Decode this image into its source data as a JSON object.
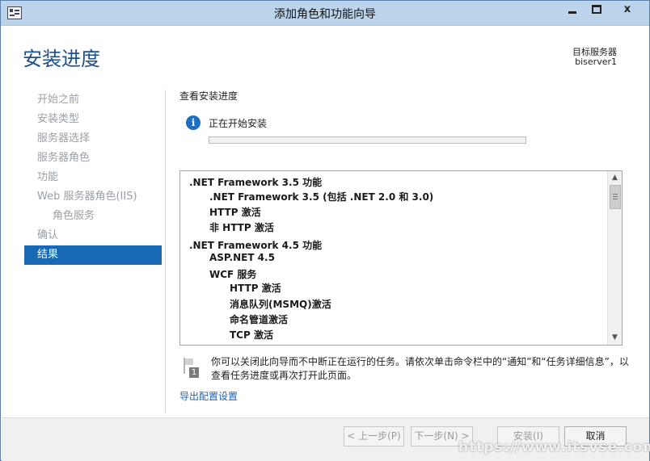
{
  "window": {
    "title": "添加角色和功能向导",
    "close_glyph": "x"
  },
  "header": {
    "title": "安装进度",
    "target_label": "目标服务器",
    "target_value": "biserver1"
  },
  "nav": {
    "items": [
      {
        "label": "开始之前",
        "active": false,
        "sub": false
      },
      {
        "label": "安装类型",
        "active": false,
        "sub": false
      },
      {
        "label": "服务器选择",
        "active": false,
        "sub": false
      },
      {
        "label": "服务器角色",
        "active": false,
        "sub": false
      },
      {
        "label": "功能",
        "active": false,
        "sub": false
      },
      {
        "label": "Web 服务器角色(IIS)",
        "active": false,
        "sub": false
      },
      {
        "label": "角色服务",
        "active": false,
        "sub": true
      },
      {
        "label": "确认",
        "active": false,
        "sub": false
      },
      {
        "label": "结果",
        "active": true,
        "sub": false
      }
    ]
  },
  "main": {
    "section_title": "查看安装进度",
    "status_icon": "info-icon",
    "status_text": "正在开始安装",
    "progress": 0,
    "features": [
      {
        "label": ".NET Framework 3.5 功能",
        "level": 0
      },
      {
        "label": ".NET Framework 3.5 (包括 .NET 2.0 和 3.0)",
        "level": 1
      },
      {
        "label": "HTTP 激活",
        "level": 1
      },
      {
        "label": "非 HTTP 激活",
        "level": 1
      },
      {
        "label": ".NET Framework 4.5 功能",
        "level": 0
      },
      {
        "label": "ASP.NET 4.5",
        "level": 1
      },
      {
        "label": "WCF 服务",
        "level": 1
      },
      {
        "label": "HTTP 激活",
        "level": 2
      },
      {
        "label": "消息队列(MSMQ)激活",
        "level": 2
      },
      {
        "label": "命名管道激活",
        "level": 2
      },
      {
        "label": "TCP 激活",
        "level": 2
      }
    ],
    "notice_icon_number": "1",
    "notice": "你可以关闭此向导而不中断正在运行的任务。请依次单击命令栏中的“通知”和“任务详细信息”，以查看任务进度或再次打开此页面。",
    "export_link": "导出配置设置"
  },
  "footer": {
    "prev": "< 上一步(P)",
    "next": "下一步(N) >",
    "install": "安装(I)",
    "cancel": "取消"
  },
  "watermark": "https://www.itsvse.com"
}
